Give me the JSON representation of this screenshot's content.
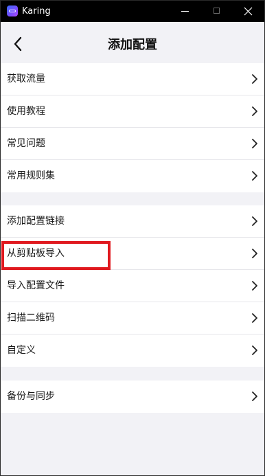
{
  "window": {
    "app_title": "Karing"
  },
  "header": {
    "title": "添加配置",
    "back_icon": "chevron-left-icon"
  },
  "groups": [
    {
      "items": [
        {
          "label": "获取流量"
        },
        {
          "label": "使用教程"
        },
        {
          "label": "常见问题"
        },
        {
          "label": "常用规则集"
        }
      ]
    },
    {
      "items": [
        {
          "label": "添加配置链接"
        },
        {
          "label": "从剪贴板导入",
          "highlighted": true
        },
        {
          "label": "导入配置文件"
        },
        {
          "label": "扫描二维码"
        },
        {
          "label": "自定义"
        }
      ]
    },
    {
      "items": [
        {
          "label": "备份与同步"
        }
      ]
    }
  ],
  "colors": {
    "background": "#f2f2f6",
    "row_background": "#ffffff",
    "highlight": "#e0191f",
    "titlebar": "#000000"
  }
}
